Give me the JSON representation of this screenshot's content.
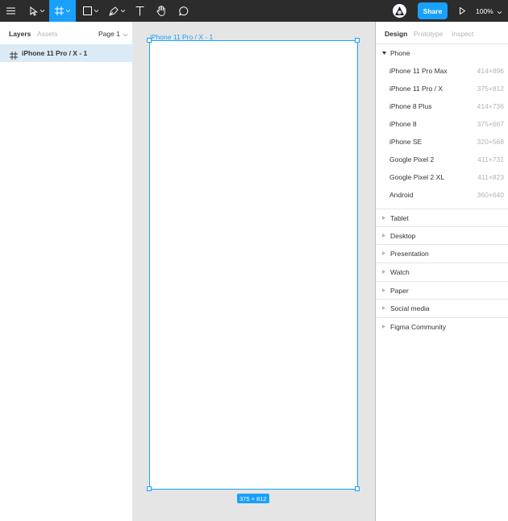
{
  "toolbar": {
    "share_label": "Share",
    "zoom_label": "100%"
  },
  "left_panel": {
    "tabs": [
      "Layers",
      "Assets"
    ],
    "page_label": "Page 1",
    "layers": [
      {
        "name": "iPhone 11 Pro / X - 1"
      }
    ]
  },
  "canvas": {
    "frame_label": "iPhone 11 Pro / X - 1",
    "size_badge": "375 × 812"
  },
  "right_panel": {
    "tabs": [
      "Design",
      "Prototype",
      "Inspect"
    ],
    "phone_group": "Phone",
    "presets": [
      {
        "name": "iPhone 11 Pro Max",
        "dims": "414×896"
      },
      {
        "name": "iPhone 11 Pro / X",
        "dims": "375×812"
      },
      {
        "name": "iPhone 8 Plus",
        "dims": "414×736"
      },
      {
        "name": "iPhone 8",
        "dims": "375×667"
      },
      {
        "name": "iPhone SE",
        "dims": "320×568"
      },
      {
        "name": "Google Pixel 2",
        "dims": "411×731"
      },
      {
        "name": "Google Pixel 2 XL",
        "dims": "411×823"
      },
      {
        "name": "Android",
        "dims": "360×640"
      }
    ],
    "sections": [
      "Tablet",
      "Desktop",
      "Presentation",
      "Watch",
      "Paper",
      "Social media",
      "Figma Community"
    ]
  },
  "colors": {
    "accent": "#18a0fb",
    "toolbar_bg": "#2c2c2c",
    "canvas_bg": "#e5e5e5",
    "selected_row": "#daebf7"
  }
}
